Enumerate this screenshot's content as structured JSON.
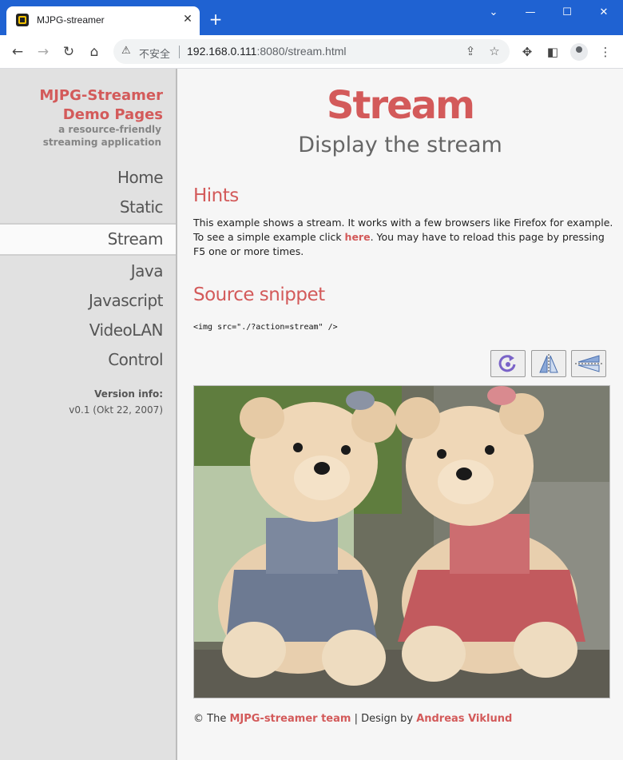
{
  "browser": {
    "tab_title": "MJPG-streamer",
    "new_tab": "+",
    "omnibox": {
      "insecure_label": "不安全",
      "url_host": "192.168.0.111",
      "url_rest": ":8080/stream.html"
    }
  },
  "sidebar": {
    "brand_line1": "MJPG-Streamer",
    "brand_line2": "Demo Pages",
    "brand_subtitle": "a resource-friendly streaming application",
    "nav": [
      "Home",
      "Static",
      "Stream",
      "Java",
      "Javascript",
      "VideoLAN",
      "Control"
    ],
    "active_index": 2,
    "version_label": "Version info:",
    "version_value": "v0.1 (Okt 22, 2007)"
  },
  "main": {
    "title": "Stream",
    "subtitle": "Display the stream",
    "hints_heading": "Hints",
    "hints_text_1": "This example shows a stream. It works with a few browsers like Firefox for example. To see a simple example click ",
    "hints_link": "here",
    "hints_text_2": ". You may have to reload this page by pressing F5 one or more times.",
    "snippet_heading": "Source snippet",
    "snippet_code": "<img src=\"./?action=stream\" />"
  },
  "footer": {
    "prefix": "© The ",
    "team_link": "MJPG-streamer team",
    "middle": " | Design by ",
    "designer_link": "Andreas Viklund"
  },
  "colors": {
    "accent": "#d35a5a",
    "chrome_blue": "#1f62d2"
  }
}
